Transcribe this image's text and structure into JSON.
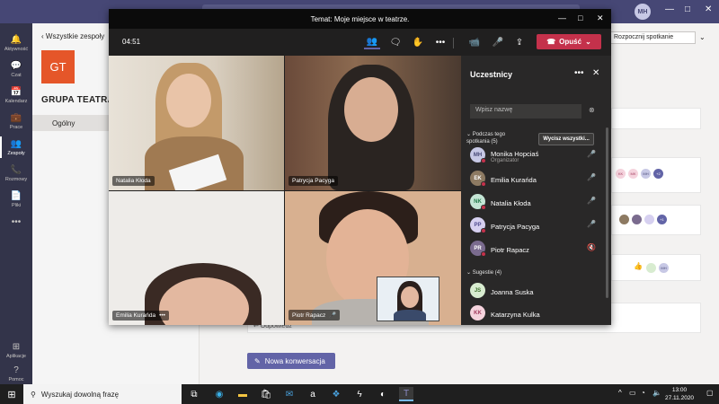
{
  "app": {
    "user_initials": "MH",
    "window_controls": [
      "—",
      "□",
      "✕"
    ]
  },
  "rail": {
    "items": [
      {
        "label": "Aktywność",
        "icon": "bell-icon",
        "glyph": "🔔"
      },
      {
        "label": "Czat",
        "icon": "chat-icon",
        "glyph": "💬"
      },
      {
        "label": "Kalendarz",
        "icon": "calendar-icon",
        "glyph": "📅"
      },
      {
        "label": "Prace",
        "icon": "briefcase-icon",
        "glyph": "💼"
      },
      {
        "label": "Zespoły",
        "icon": "teams-icon",
        "glyph": "👥"
      },
      {
        "label": "Rozmowy",
        "icon": "phone-icon",
        "glyph": "📞"
      },
      {
        "label": "Pliki",
        "icon": "file-icon",
        "glyph": "📄"
      },
      {
        "label": "",
        "icon": "more-icon",
        "glyph": "•••"
      }
    ],
    "bottom": [
      {
        "label": "Aplikacje",
        "icon": "apps-icon",
        "glyph": "⊞"
      },
      {
        "label": "Pomoc",
        "icon": "help-icon",
        "glyph": "?"
      }
    ]
  },
  "team": {
    "back_label": "Wszystkie zespoły",
    "tile_initials": "GT",
    "tile_color": "#e55629",
    "name": "GRUPA TEATRAL",
    "channel": "Ogólny"
  },
  "main": {
    "start_meeting_label": "Rozpocznij spotkanie",
    "reply_label": "↩ Odpowiedz",
    "new_conversation_label": "Nowa konwersacja",
    "badge_plus2": "+2",
    "badge_plus1": "+1",
    "mini_initials": [
      "KK",
      "MK",
      "MH",
      "MH"
    ]
  },
  "meeting": {
    "title": "Temat: Moje miejsce w teatrze.",
    "timer": "04:51",
    "leave_label": "Opuść",
    "leave_color": "#c4314b",
    "accent_color": "#6264a7",
    "videos": [
      {
        "name": "Natalia Kłoda"
      },
      {
        "name": "Patrycja Pacyga"
      },
      {
        "name": "Emilia Kurańda",
        "extra": "•••"
      },
      {
        "name": "Piotr Rapacz",
        "extra": "🎤"
      }
    ]
  },
  "panel": {
    "title": "Uczestnicy",
    "search_placeholder": "Wpisz nazwę",
    "section_in_meeting": "Podczas tego spotkania (5)",
    "mute_all_label": "Wycisz wszystki...",
    "section_suggestions": "Sugestie (4)",
    "in_meeting": [
      {
        "initials": "MH",
        "name": "Monika Hopciaś",
        "role": "Organizator",
        "bg": "#c7c8e5",
        "fg": "#464775",
        "mic": "🎤"
      },
      {
        "initials": "EK",
        "name": "Emilia Kurańda",
        "role": "",
        "bg": "#8d7a62",
        "fg": "#ffffff",
        "mic": "🎤"
      },
      {
        "initials": "NK",
        "name": "Natalia Kłoda",
        "role": "",
        "bg": "#c4e5d5",
        "fg": "#237b4b",
        "mic": "🎤"
      },
      {
        "initials": "PP",
        "name": "Patrycja Pacyga",
        "role": "",
        "bg": "#d6d0f0",
        "fg": "#4f4b8f",
        "mic": "🎤"
      },
      {
        "initials": "PR",
        "name": "Piotr Rapacz",
        "role": "",
        "bg": "#7a6b8e",
        "fg": "#ffffff",
        "mic": "🔇"
      }
    ],
    "suggestions": [
      {
        "initials": "JS",
        "name": "Joanna Suska",
        "bg": "#d8ecd0",
        "fg": "#3b6d2a"
      },
      {
        "initials": "KK",
        "name": "Katarzyna Kulka",
        "bg": "#f5d3dd",
        "fg": "#a33c5e"
      }
    ]
  },
  "taskbar": {
    "search_placeholder": "Wyszukaj dowolną frazę",
    "time": "13:00",
    "date": "27.11.2020"
  }
}
